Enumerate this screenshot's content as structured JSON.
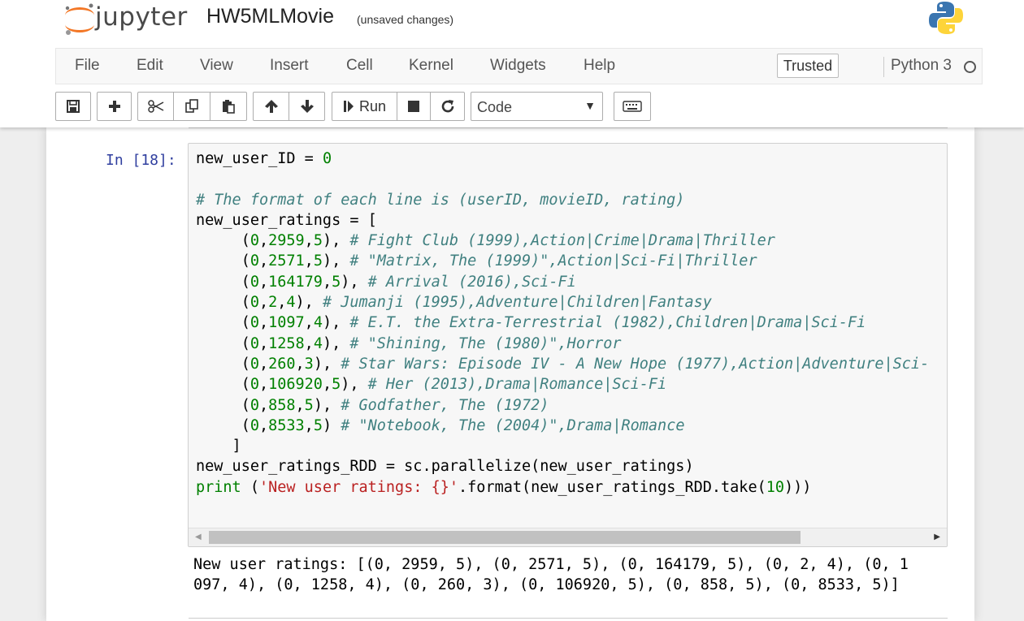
{
  "header": {
    "logo_text": "jupyter",
    "notebook_name": "HW5MLMovie",
    "save_status": "(unsaved changes)"
  },
  "menubar": {
    "items": [
      "File",
      "Edit",
      "View",
      "Insert",
      "Cell",
      "Kernel",
      "Widgets",
      "Help"
    ],
    "trusted": "Trusted",
    "kernel_name": "Python 3"
  },
  "toolbar": {
    "buttons": [
      "save-icon",
      "plus-icon",
      "cut-icon",
      "copy-icon",
      "paste-icon",
      "arrow-up-icon",
      "arrow-down-icon",
      "run-icon",
      "stop-icon",
      "restart-icon",
      "keyboard-icon"
    ],
    "run_label": "Run",
    "cell_type": "Code"
  },
  "cell": {
    "prompt": "In [18]:",
    "code_lines": [
      [
        [
          "v",
          "new_user_ID = "
        ],
        [
          "n",
          "0"
        ]
      ],
      [],
      [
        [
          "c",
          "# The format of each line is (userID, movieID, rating)"
        ]
      ],
      [
        [
          "v",
          "new_user_ratings = ["
        ]
      ],
      [
        [
          "v",
          "     ("
        ],
        [
          "n",
          "0"
        ],
        [
          "v",
          ","
        ],
        [
          "n",
          "2959"
        ],
        [
          "v",
          ","
        ],
        [
          "n",
          "5"
        ],
        [
          "v",
          "), "
        ],
        [
          "c",
          "# Fight Club (1999),Action|Crime|Drama|Thriller"
        ]
      ],
      [
        [
          "v",
          "     ("
        ],
        [
          "n",
          "0"
        ],
        [
          "v",
          ","
        ],
        [
          "n",
          "2571"
        ],
        [
          "v",
          ","
        ],
        [
          "n",
          "5"
        ],
        [
          "v",
          "), "
        ],
        [
          "c",
          "# \"Matrix, The (1999)\",Action|Sci-Fi|Thriller"
        ]
      ],
      [
        [
          "v",
          "     ("
        ],
        [
          "n",
          "0"
        ],
        [
          "v",
          ","
        ],
        [
          "n",
          "164179"
        ],
        [
          "v",
          ","
        ],
        [
          "n",
          "5"
        ],
        [
          "v",
          "), "
        ],
        [
          "c",
          "# Arrival (2016),Sci-Fi"
        ]
      ],
      [
        [
          "v",
          "     ("
        ],
        [
          "n",
          "0"
        ],
        [
          "v",
          ","
        ],
        [
          "n",
          "2"
        ],
        [
          "v",
          ","
        ],
        [
          "n",
          "4"
        ],
        [
          "v",
          "), "
        ],
        [
          "c",
          "# Jumanji (1995),Adventure|Children|Fantasy"
        ]
      ],
      [
        [
          "v",
          "     ("
        ],
        [
          "n",
          "0"
        ],
        [
          "v",
          ","
        ],
        [
          "n",
          "1097"
        ],
        [
          "v",
          ","
        ],
        [
          "n",
          "4"
        ],
        [
          "v",
          "), "
        ],
        [
          "c",
          "# E.T. the Extra-Terrestrial (1982),Children|Drama|Sci-Fi"
        ]
      ],
      [
        [
          "v",
          "     ("
        ],
        [
          "n",
          "0"
        ],
        [
          "v",
          ","
        ],
        [
          "n",
          "1258"
        ],
        [
          "v",
          ","
        ],
        [
          "n",
          "4"
        ],
        [
          "v",
          "), "
        ],
        [
          "c",
          "# \"Shining, The (1980)\",Horror"
        ]
      ],
      [
        [
          "v",
          "     ("
        ],
        [
          "n",
          "0"
        ],
        [
          "v",
          ","
        ],
        [
          "n",
          "260"
        ],
        [
          "v",
          ","
        ],
        [
          "n",
          "3"
        ],
        [
          "v",
          "), "
        ],
        [
          "c",
          "# Star Wars: Episode IV - A New Hope (1977),Action|Adventure|Sci-"
        ]
      ],
      [
        [
          "v",
          "     ("
        ],
        [
          "n",
          "0"
        ],
        [
          "v",
          ","
        ],
        [
          "n",
          "106920"
        ],
        [
          "v",
          ","
        ],
        [
          "n",
          "5"
        ],
        [
          "v",
          "), "
        ],
        [
          "c",
          "# Her (2013),Drama|Romance|Sci-Fi"
        ]
      ],
      [
        [
          "v",
          "     ("
        ],
        [
          "n",
          "0"
        ],
        [
          "v",
          ","
        ],
        [
          "n",
          "858"
        ],
        [
          "v",
          ","
        ],
        [
          "n",
          "5"
        ],
        [
          "v",
          "), "
        ],
        [
          "c",
          "# Godfather, The (1972)"
        ]
      ],
      [
        [
          "v",
          "     ("
        ],
        [
          "n",
          "0"
        ],
        [
          "v",
          ","
        ],
        [
          "n",
          "8533"
        ],
        [
          "v",
          ","
        ],
        [
          "n",
          "5"
        ],
        [
          "v",
          ") "
        ],
        [
          "c",
          "# \"Notebook, The (2004)\",Drama|Romance"
        ]
      ],
      [
        [
          "v",
          "    ]"
        ]
      ],
      [
        [
          "v",
          "new_user_ratings_RDD = sc.parallelize(new_user_ratings)"
        ]
      ],
      [
        [
          "k",
          "print"
        ],
        [
          "v",
          " ("
        ],
        [
          "s",
          "'New user ratings: {}'"
        ],
        [
          "v",
          ".format(new_user_ratings_RDD.take("
        ],
        [
          "n",
          "10"
        ],
        [
          "v",
          ")))"
        ]
      ]
    ],
    "output": "New user ratings: [(0, 2959, 5), (0, 2571, 5), (0, 164179, 5), (0, 2, 4), (0, 1\n097, 4), (0, 1258, 4), (0, 260, 3), (0, 106920, 5), (0, 858, 5), (0, 8533, 5)]"
  },
  "colors": {
    "comment": "#408080",
    "number": "#008000",
    "keyword": "#008000",
    "string": "#ba2121",
    "prompt": "#303f9f",
    "jupyter_orange": "#f37726"
  }
}
